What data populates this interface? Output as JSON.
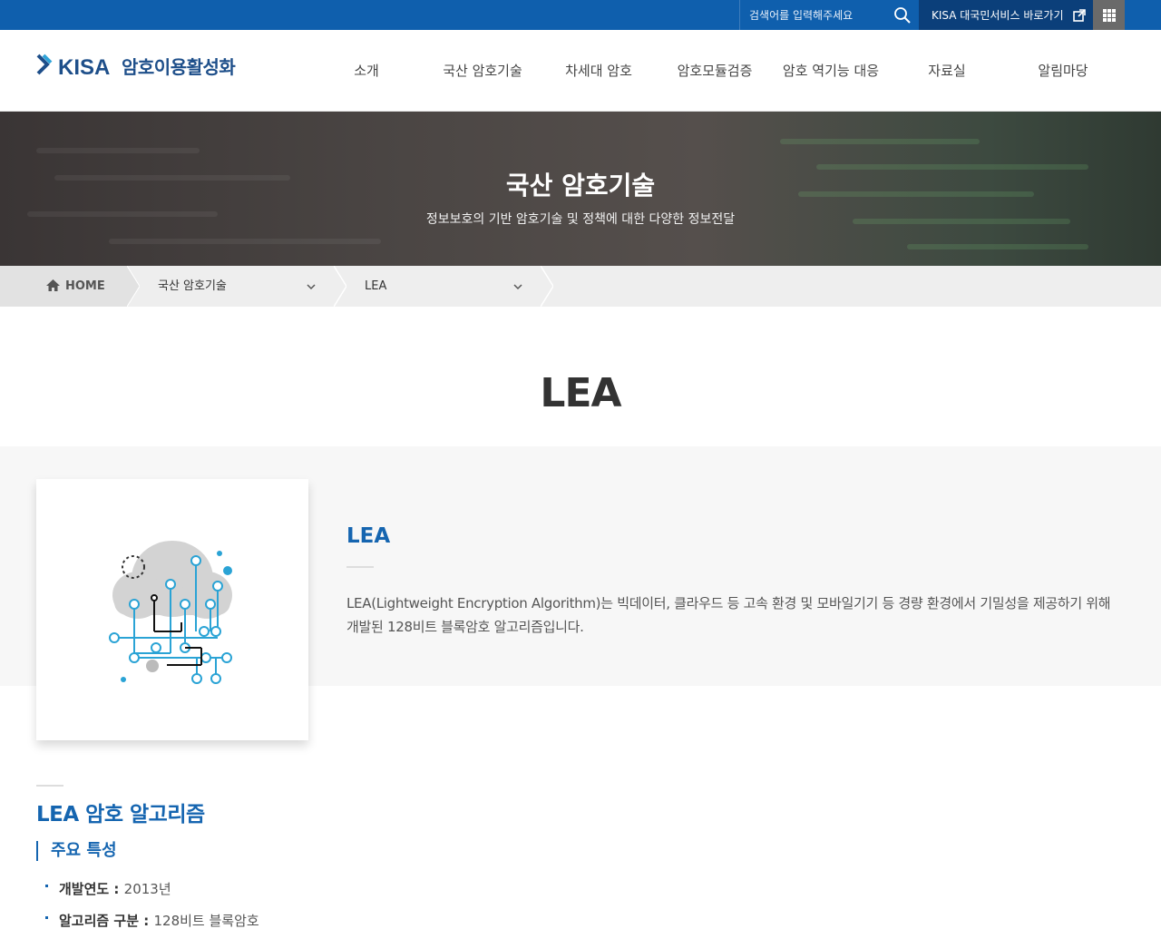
{
  "topbar": {
    "search_placeholder": "검색어를 입력해주세요",
    "kisa_link": "KISA 대국민서비스 바로가기"
  },
  "header": {
    "logo_text": "KISA",
    "logo_sub": "암호이용활성화"
  },
  "gnb": [
    "소개",
    "국산 암호기술",
    "차세대 암호",
    "암호모듈검증",
    "암호 역기능 대응",
    "자료실",
    "알림마당"
  ],
  "hero": {
    "title": "국산 암호기술",
    "subtitle": "정보보호의 기반 암호기술 및 정책에 대한 다양한 정보전달"
  },
  "breadcrumb": {
    "home": "HOME",
    "level1": "국산 암호기술",
    "level2": "LEA"
  },
  "page_title": "LEA",
  "intro": {
    "heading": "LEA",
    "text": "LEA(Lightweight Encryption Algorithm)는 빅데이터, 클라우드 등 고속 환경 및 모바일기기 등 경량 환경에서 기밀성을 제공하기 위해 개발된 128비트 블록암호 알고리즘입니다."
  },
  "section": {
    "title": "LEA 암호 알고리즘",
    "subtitle": "주요 특성",
    "features": [
      {
        "label": "개발연도",
        "value": "2013년"
      },
      {
        "label": "알고리즘 구분",
        "value": "128비트 블록암호"
      }
    ]
  },
  "colors": {
    "topbar": "#0f5fad",
    "kisa_link": "#0b3f7a",
    "accent": "#1565b0"
  }
}
